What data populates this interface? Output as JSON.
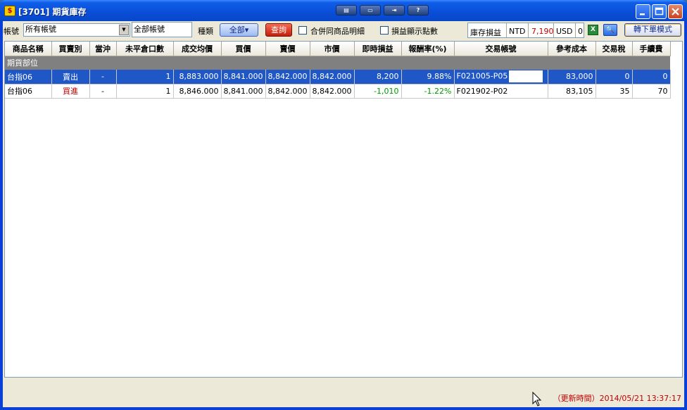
{
  "window": {
    "title": "[3701] 期貨庫存",
    "tool_buttons": [
      "▤",
      "▭",
      "⇥",
      "?"
    ],
    "minimize_icon": "minimize-icon",
    "maximize_icon": "maximize-icon",
    "close_icon": "close-icon"
  },
  "toolbar": {
    "account_label": "帳號",
    "account_select": "所有帳號",
    "account_text": "全部帳號",
    "type_label": "種類",
    "type_button": "全部▾",
    "query_button": "查詢",
    "merge_label": "合併同商品明細",
    "points_label": "損益顯示點數",
    "pnl_label": "庫存損益",
    "ntd_label": "NTD",
    "ntd_value": "7,190",
    "usd_label": "USD",
    "usd_value": "0",
    "mode_button": "轉下單模式"
  },
  "table": {
    "headers": [
      "商品名稱",
      "買賣別",
      "當沖",
      "未平倉口數",
      "成交均價",
      "買價",
      "賣價",
      "市價",
      "即時損益",
      "報酬率(%)",
      "交易帳號",
      "參考成本",
      "交易稅",
      "手續費"
    ],
    "group_label": "期貨部位",
    "rows": [
      {
        "product": "台指06",
        "side": "賣出",
        "daytrade": "-",
        "open_qty": "1",
        "avg_price": "8,883.000",
        "bid": "8,841.000",
        "ask": "8,842.000",
        "market": "8,842.000",
        "pnl": "8,200",
        "return": "9.88%",
        "account": "F021005-P05",
        "ref_cost": "83,000",
        "tax": "0",
        "fee": "0"
      },
      {
        "product": "台指06",
        "side": "買進",
        "daytrade": "-",
        "open_qty": "1",
        "avg_price": "8,846.000",
        "bid": "8,841.000",
        "ask": "8,842.000",
        "market": "8,842.000",
        "pnl": "-1,010",
        "return": "-1.22%",
        "account": "F021902-P02",
        "ref_cost": "83,105",
        "tax": "35",
        "fee": "70"
      }
    ]
  },
  "status": {
    "update_time": "（更新時間）2014/05/21 13:37:17"
  },
  "colors": {
    "title_bar": "#0a4fd9",
    "selection": "#1f58c6",
    "sell": "#009900",
    "buy": "#c00000",
    "loss": "#009900",
    "profit": "#c00000"
  }
}
